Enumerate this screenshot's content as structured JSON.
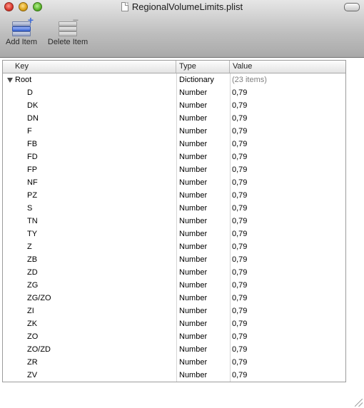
{
  "window": {
    "title": "RegionalVolumeLimits.plist"
  },
  "toolbar": {
    "add_label": "Add Item",
    "delete_label": "Delete Item"
  },
  "columns": {
    "key": "Key",
    "type": "Type",
    "value": "Value"
  },
  "root": {
    "key": "Root",
    "type": "Dictionary",
    "value": "(23 items)",
    "expanded": true
  },
  "items": [
    {
      "key": "D",
      "type": "Number",
      "value": "0,79"
    },
    {
      "key": "DK",
      "type": "Number",
      "value": "0,79"
    },
    {
      "key": "DN",
      "type": "Number",
      "value": "0,79"
    },
    {
      "key": "F",
      "type": "Number",
      "value": "0,79"
    },
    {
      "key": "FB",
      "type": "Number",
      "value": "0,79"
    },
    {
      "key": "FD",
      "type": "Number",
      "value": "0,79"
    },
    {
      "key": "FP",
      "type": "Number",
      "value": "0,79"
    },
    {
      "key": "NF",
      "type": "Number",
      "value": "0,79"
    },
    {
      "key": "PZ",
      "type": "Number",
      "value": "0,79"
    },
    {
      "key": "S",
      "type": "Number",
      "value": "0,79"
    },
    {
      "key": "TN",
      "type": "Number",
      "value": "0,79"
    },
    {
      "key": "TY",
      "type": "Number",
      "value": "0,79"
    },
    {
      "key": "Z",
      "type": "Number",
      "value": "0,79"
    },
    {
      "key": "ZB",
      "type": "Number",
      "value": "0,79"
    },
    {
      "key": "ZD",
      "type": "Number",
      "value": "0,79"
    },
    {
      "key": "ZG",
      "type": "Number",
      "value": "0,79"
    },
    {
      "key": "ZG/ZO",
      "type": "Number",
      "value": "0,79"
    },
    {
      "key": "ZI",
      "type": "Number",
      "value": "0,79"
    },
    {
      "key": "ZK",
      "type": "Number",
      "value": "0,79"
    },
    {
      "key": "ZO",
      "type": "Number",
      "value": "0,79"
    },
    {
      "key": "ZO/ZD",
      "type": "Number",
      "value": "0,79"
    },
    {
      "key": "ZR",
      "type": "Number",
      "value": "0,79"
    },
    {
      "key": "ZV",
      "type": "Number",
      "value": "0,79"
    }
  ],
  "icons": {
    "close": "close-button-icon",
    "minimize": "minimize-button-icon",
    "zoom": "zoom-button-icon",
    "document": "plist-document-icon",
    "add": "add-item-icon",
    "delete": "delete-item-icon",
    "disclosure": "disclosure-triangle-icon",
    "resize": "resize-grip-icon"
  }
}
